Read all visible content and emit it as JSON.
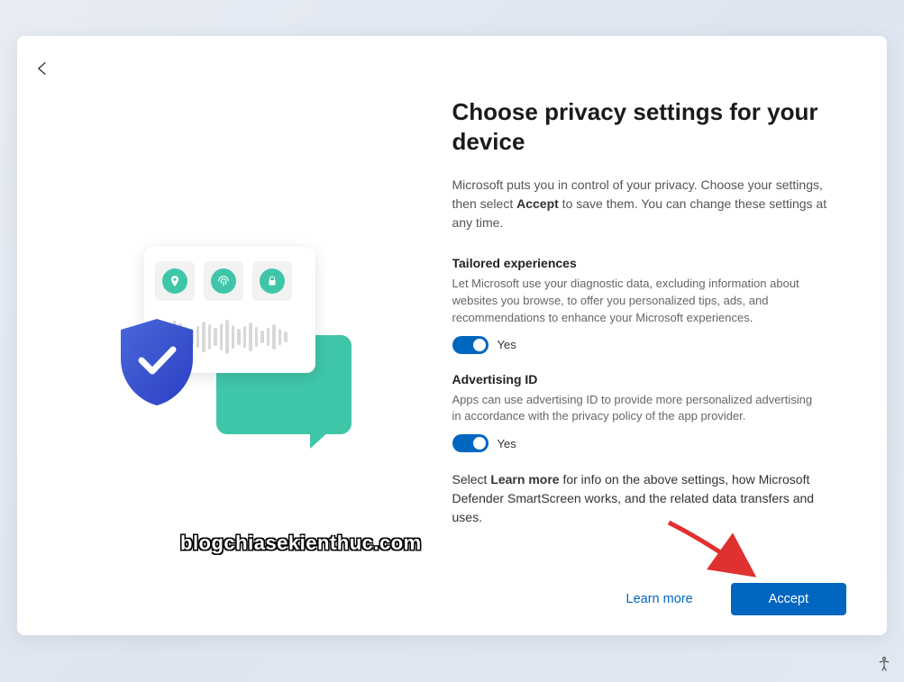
{
  "title": "Choose privacy settings for your device",
  "subtitle_pre": "Microsoft puts you in control of your privacy. Choose your settings, then select ",
  "subtitle_bold": "Accept",
  "subtitle_post": " to save them. You can change these settings at any time.",
  "settings": {
    "tailored": {
      "title": "Tailored experiences",
      "desc": "Let Microsoft use your diagnostic data, excluding information about websites you browse, to offer you personalized tips, ads, and recommendations to enhance your Microsoft experiences.",
      "state_label": "Yes"
    },
    "advertising": {
      "title": "Advertising ID",
      "desc": "Apps can use advertising ID to provide more personalized advertising in accordance with the privacy policy of the app provider.",
      "state_label": "Yes"
    }
  },
  "footer_pre": "Select ",
  "footer_bold": "Learn more",
  "footer_post": " for info on the above settings, how Microsoft Defender SmartScreen works, and the related data transfers and uses.",
  "buttons": {
    "learn_more": "Learn more",
    "accept": "Accept"
  },
  "watermark": "blogchiasekienthuc.com"
}
